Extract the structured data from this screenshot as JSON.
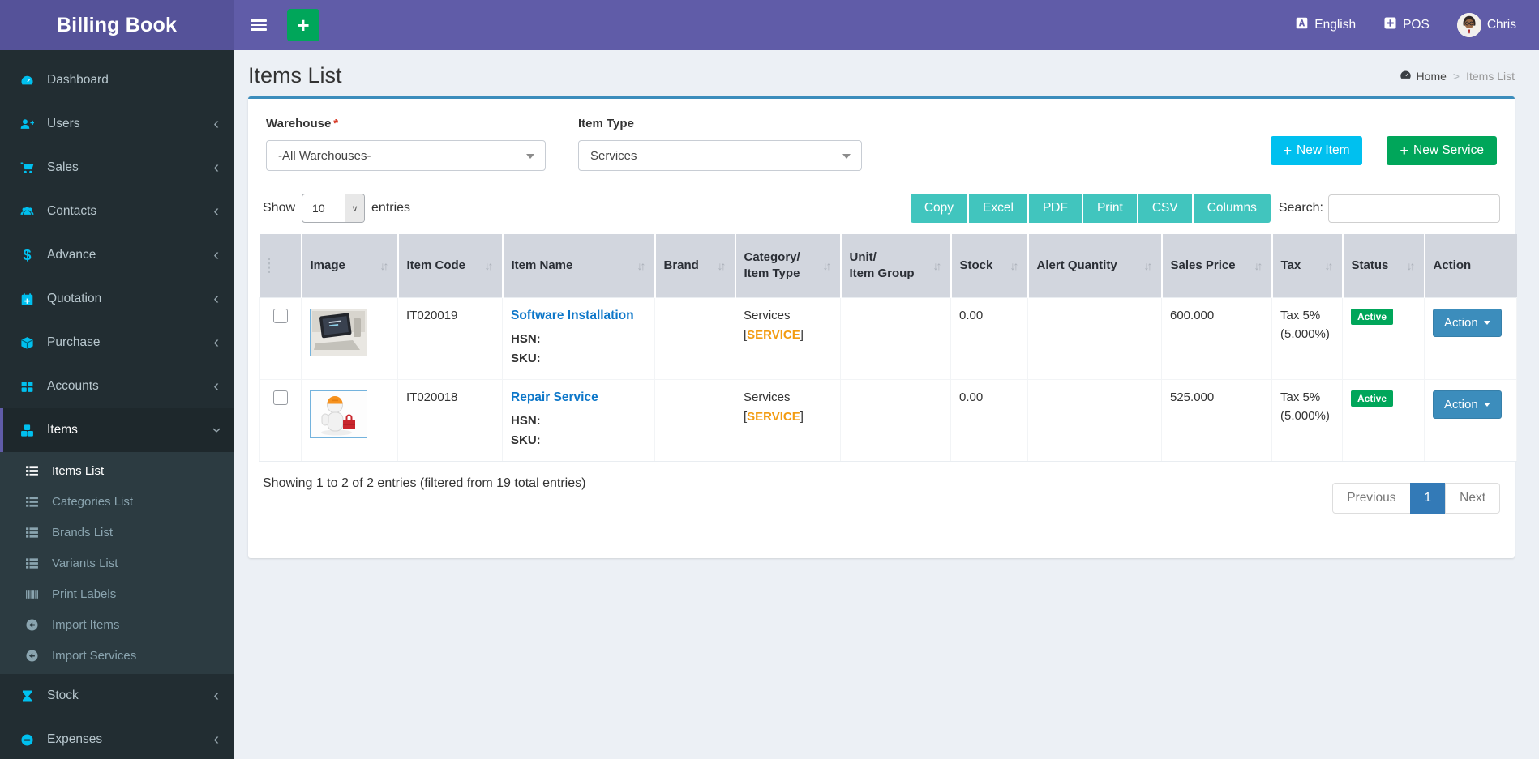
{
  "app": {
    "title": "Billing Book"
  },
  "navbar": {
    "language": "English",
    "pos": "POS",
    "user": "Chris"
  },
  "sidebar": {
    "items": [
      {
        "label": "Dashboard",
        "icon": "tachometer",
        "chevron": null,
        "active": false
      },
      {
        "label": "Users",
        "icon": "user-plus",
        "chevron": "left",
        "active": false
      },
      {
        "label": "Sales",
        "icon": "cart",
        "chevron": "left",
        "active": false
      },
      {
        "label": "Contacts",
        "icon": "users",
        "chevron": "left",
        "active": false
      },
      {
        "label": "Advance",
        "icon": "dollar",
        "chevron": "left",
        "active": false
      },
      {
        "label": "Quotation",
        "icon": "calendar-plus",
        "chevron": "left",
        "active": false
      },
      {
        "label": "Purchase",
        "icon": "cube",
        "chevron": "left",
        "active": false
      },
      {
        "label": "Accounts",
        "icon": "grid",
        "chevron": "left",
        "active": false
      },
      {
        "label": "Items",
        "icon": "cubes",
        "chevron": "down",
        "active": true,
        "submenu": [
          {
            "label": "Items List",
            "icon": "list",
            "active": true
          },
          {
            "label": "Categories List",
            "icon": "list",
            "active": false
          },
          {
            "label": "Brands List",
            "icon": "list",
            "active": false
          },
          {
            "label": "Variants List",
            "icon": "list",
            "active": false
          },
          {
            "label": "Print Labels",
            "icon": "barcode",
            "active": false
          },
          {
            "label": "Import Items",
            "icon": "import",
            "active": false
          },
          {
            "label": "Import Services",
            "icon": "import",
            "active": false
          }
        ]
      },
      {
        "label": "Stock",
        "icon": "hourglass",
        "chevron": "left",
        "active": false
      },
      {
        "label": "Expenses",
        "icon": "minus-circle",
        "chevron": "left",
        "active": false
      }
    ]
  },
  "page": {
    "title": "Items List",
    "breadcrumb": {
      "home": "Home",
      "separator": ">",
      "current": "Items List"
    }
  },
  "filters": {
    "warehouse_label": "Warehouse",
    "warehouse_required": "*",
    "warehouse_value": "-All Warehouses-",
    "item_type_label": "Item Type",
    "item_type_value": "Services"
  },
  "actions": {
    "new_item": "New Item",
    "new_service": "New Service"
  },
  "table_controls": {
    "show_label": "Show",
    "page_length": "10",
    "entries_label": "entries",
    "export_buttons": [
      "Copy",
      "Excel",
      "PDF",
      "Print",
      "CSV",
      "Columns"
    ],
    "search_label": "Search:",
    "search_value": ""
  },
  "table": {
    "columns": [
      {
        "label": "",
        "sortable": false
      },
      {
        "label": "Image",
        "sortable": true
      },
      {
        "label": "Item Code",
        "sortable": true
      },
      {
        "label": "Item Name",
        "sortable": true
      },
      {
        "label": "Brand",
        "sortable": true
      },
      {
        "label": "Category/\nItem Type",
        "sortable": true
      },
      {
        "label": "Unit/\nItem Group",
        "sortable": true
      },
      {
        "label": "Stock",
        "sortable": true
      },
      {
        "label": "Alert Quantity",
        "sortable": true
      },
      {
        "label": "Sales Price",
        "sortable": true
      },
      {
        "label": "Tax",
        "sortable": true
      },
      {
        "label": "Status",
        "sortable": true
      },
      {
        "label": "Action",
        "sortable": false
      }
    ],
    "rows": [
      {
        "image": "laptop",
        "item_code": "IT020019",
        "item_name": "Software Installation",
        "hsn_label": "HSN:",
        "sku_label": "SKU:",
        "brand": "",
        "category": "Services",
        "item_type_tag": "SERVICE",
        "unit": "",
        "stock": "0.00",
        "alert_quantity": "",
        "sales_price": "600.000",
        "tax_name": "Tax 5%",
        "tax_rate": "(5.000%)",
        "status": "Active",
        "action_label": "Action"
      },
      {
        "image": "repairman",
        "item_code": "IT020018",
        "item_name": "Repair Service",
        "hsn_label": "HSN:",
        "sku_label": "SKU:",
        "brand": "",
        "category": "Services",
        "item_type_tag": "SERVICE",
        "unit": "",
        "stock": "0.00",
        "alert_quantity": "",
        "sales_price": "525.000",
        "tax_name": "Tax 5%",
        "tax_rate": "(5.000%)",
        "status": "Active",
        "action_label": "Action"
      }
    ]
  },
  "table_footer": {
    "summary": "Showing 1 to 2 of 2 entries (filtered from 19 total entries)",
    "pagination": {
      "previous": "Previous",
      "pages": [
        "1"
      ],
      "active_page": "1",
      "next": "Next"
    }
  },
  "colors": {
    "navbar_purple": "#605ca8",
    "logo_purple": "#555299",
    "sidebar_dark": "#222d32",
    "sidebar_icon_cyan": "#00c0ef",
    "box_top_blue": "#3c8dbc",
    "new_item_cyan": "#00c0ef",
    "new_service_green": "#00a65a",
    "export_teal": "#41c5be",
    "link_blue": "#0d77c9",
    "service_tag_orange": "#f39c12",
    "active_badge_green": "#00a65a",
    "action_blue": "#3c8dbc",
    "pagination_active_blue": "#337ab7"
  }
}
